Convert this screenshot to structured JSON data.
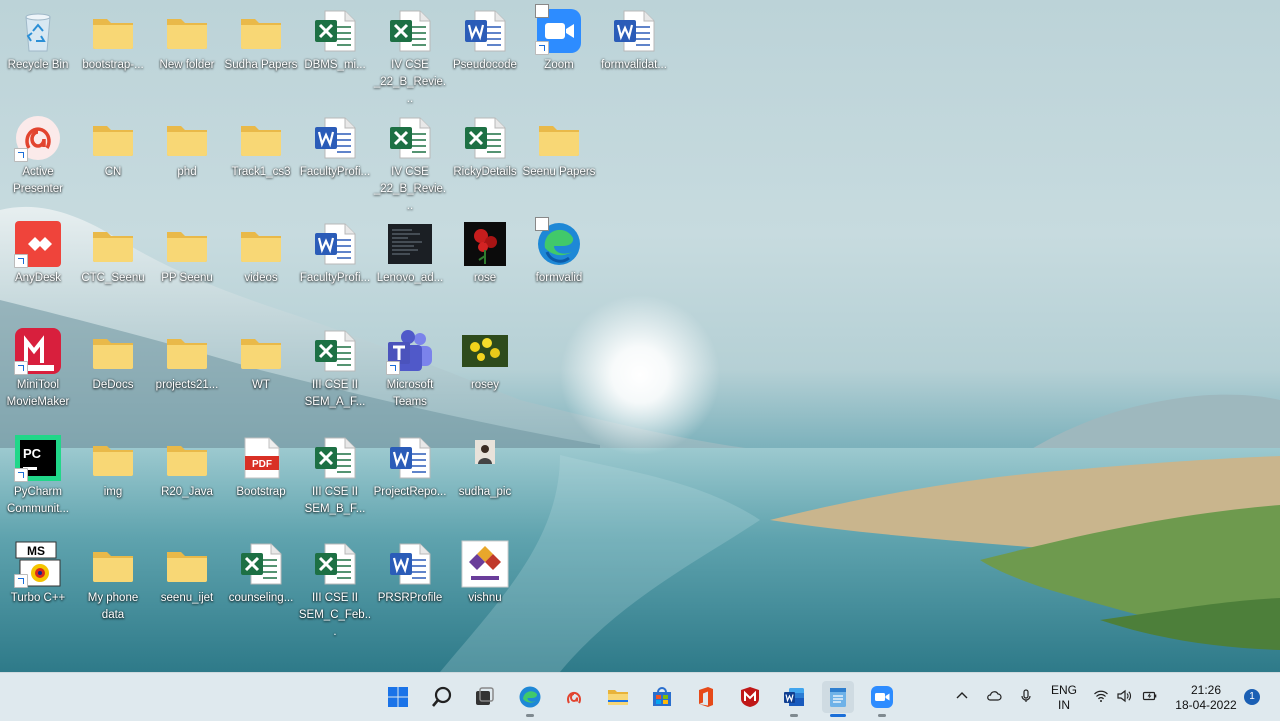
{
  "desktop": {
    "icons": [
      {
        "label": "Recycle Bin",
        "icon": "recycle-bin-icon"
      },
      {
        "label": "bootstrap-...",
        "icon": "folder-icon"
      },
      {
        "label": "New folder",
        "icon": "folder-icon"
      },
      {
        "label": "Sudha Papers",
        "icon": "folder-icon"
      },
      {
        "label": "DBMS_mi...",
        "icon": "excel-file-icon"
      },
      {
        "label": "IV CSE _22_B_Revie...",
        "icon": "excel-file-icon"
      },
      {
        "label": "Pseudocode",
        "icon": "word-file-icon"
      },
      {
        "label": "Zoom",
        "icon": "zoom-app-icon"
      },
      {
        "label": "formvalidat...",
        "icon": "word-file-icon"
      },
      {
        "label": "Active Presenter",
        "icon": "active-presenter-icon"
      },
      {
        "label": "CN",
        "icon": "folder-icon"
      },
      {
        "label": "phd",
        "icon": "folder-icon"
      },
      {
        "label": "Track1_cs3",
        "icon": "folder-icon"
      },
      {
        "label": "FacultyProfi...",
        "icon": "word-file-icon"
      },
      {
        "label": "IV CSE _22_B_Revie...",
        "icon": "excel-file-icon"
      },
      {
        "label": "RickyDetails",
        "icon": "excel-file-icon"
      },
      {
        "label": "Seenu Papers",
        "icon": "folder-icon"
      },
      {
        "label": "AnyDesk",
        "icon": "anydesk-icon"
      },
      {
        "label": "CTC_Seenu",
        "icon": "folder-icon"
      },
      {
        "label": "PP Seenu",
        "icon": "folder-icon"
      },
      {
        "label": "videos",
        "icon": "folder-icon"
      },
      {
        "label": "FacultyProfi...",
        "icon": "word-file-icon"
      },
      {
        "label": "Lenovo_ad...",
        "icon": "screenshot-image-icon"
      },
      {
        "label": "rose",
        "icon": "rose-image-icon"
      },
      {
        "label": "formvalid",
        "icon": "edge-html-file-icon"
      },
      {
        "label": "MiniTool MovieMaker",
        "icon": "minitool-moviemaker-icon"
      },
      {
        "label": "DeDocs",
        "icon": "folder-icon"
      },
      {
        "label": "projects21...",
        "icon": "folder-icon"
      },
      {
        "label": "WT",
        "icon": "folder-icon"
      },
      {
        "label": "III CSE II SEM_A_F...",
        "icon": "excel-file-icon"
      },
      {
        "label": "Microsoft Teams",
        "icon": "teams-app-icon"
      },
      {
        "label": "rosey",
        "icon": "flower-image-icon"
      },
      {
        "label": "PyCharm Communit...",
        "icon": "pycharm-icon"
      },
      {
        "label": "img",
        "icon": "folder-icon"
      },
      {
        "label": "R20_Java",
        "icon": "folder-icon"
      },
      {
        "label": "Bootstrap",
        "icon": "pdf-file-icon"
      },
      {
        "label": "III CSE II SEM_B_F...",
        "icon": "excel-file-icon"
      },
      {
        "label": "ProjectRepo...",
        "icon": "word-file-icon"
      },
      {
        "label": "sudha_pic",
        "icon": "photo-image-icon"
      },
      {
        "label": "Turbo C++",
        "icon": "turbo-cpp-icon"
      },
      {
        "label": "My phone data",
        "icon": "folder-icon"
      },
      {
        "label": "seenu_ijet",
        "icon": "folder-icon"
      },
      {
        "label": "counseling...",
        "icon": "excel-file-icon"
      },
      {
        "label": "III CSE II SEM_C_Feb...",
        "icon": "excel-file-icon"
      },
      {
        "label": "PRSRProfile",
        "icon": "word-file-icon"
      },
      {
        "label": "vishnu",
        "icon": "vishnu-logo-image-icon"
      }
    ]
  },
  "taskbar": {
    "apps": [
      {
        "name": "start",
        "icon": "windows-start-icon"
      },
      {
        "name": "search",
        "icon": "search-icon"
      },
      {
        "name": "task-view",
        "icon": "task-view-icon"
      },
      {
        "name": "edge",
        "icon": "edge-browser-icon"
      },
      {
        "name": "active-presenter",
        "icon": "active-presenter-icon"
      },
      {
        "name": "file-explorer",
        "icon": "file-explorer-icon"
      },
      {
        "name": "microsoft-store",
        "icon": "store-icon"
      },
      {
        "name": "office",
        "icon": "office-icon"
      },
      {
        "name": "mcafee",
        "icon": "mcafee-icon"
      },
      {
        "name": "word",
        "icon": "word-app-icon"
      },
      {
        "name": "notepad",
        "icon": "notepad-icon"
      },
      {
        "name": "zoom",
        "icon": "zoom-app-icon"
      }
    ],
    "tray": {
      "language_line1": "ENG",
      "language_line2": "IN",
      "time": "21:26",
      "date": "18-04-2022",
      "notification_count": "1"
    }
  },
  "colors": {
    "folder": "#f8d775",
    "excel": "#1d7044",
    "word": "#2b5cb8",
    "taskbar": "#dfe9ee",
    "accent": "#1a6ed8"
  }
}
